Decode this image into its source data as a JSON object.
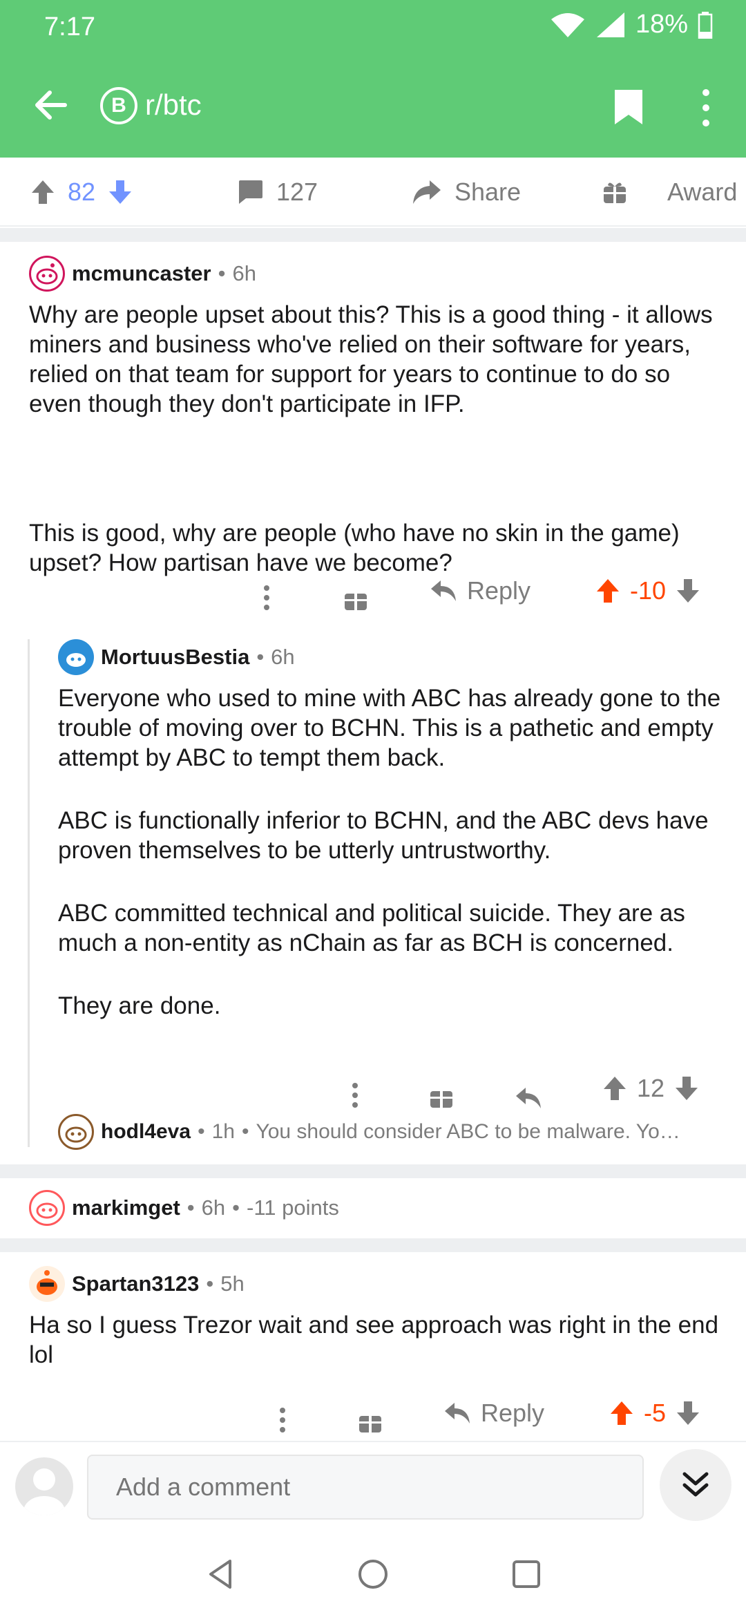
{
  "status": {
    "time": "7:17",
    "battery": "18%"
  },
  "appbar": {
    "subreddit": "r/btc",
    "sub_icon_letter": "B"
  },
  "post_actions": {
    "score": "82",
    "comments": "127",
    "share": "Share",
    "award": "Award"
  },
  "comments": [
    {
      "user": "mcmuncaster",
      "age": "6h",
      "body": [
        "Why are people upset about this? This is a good thing - it allows miners and business who've relied on their software for years, relied on that team for support for years to continue to do so even though they don't participate in IFP.",
        "",
        "This is good, why are people (who have no skin in the game) upset? How partisan have we become?"
      ],
      "reply": "Reply",
      "score": "-10"
    },
    {
      "user": "MortuusBestia",
      "age": "6h",
      "body": [
        "Everyone who used to mine with ABC has already gone to the trouble of moving over to BCHN. This is a pathetic and empty attempt by ABC to tempt them back.",
        "ABC is functionally inferior to BCHN, and the ABC devs have proven themselves to be utterly untrustworthy.",
        "ABC committed technical and political suicide. They are as much a non-entity as nChain as far as BCH is concerned.",
        "They are done."
      ],
      "score": "12"
    },
    {
      "user": "hodl4eva",
      "age": "1h",
      "preview": "You should consider ABC to be malware.  Yo…"
    },
    {
      "user": "markimget",
      "age": "6h",
      "points": "-11 points"
    },
    {
      "user": "Spartan3123",
      "age": "5h",
      "body": [
        "Ha so I guess Trezor wait and see approach was right in the end lol"
      ],
      "reply": "Reply",
      "score": "-5"
    }
  ],
  "composer": {
    "placeholder": "Add a comment"
  },
  "colors": {
    "appbar": "#5fcb76",
    "upvoted": "#ff4500",
    "accent_blue": "#7193ff"
  }
}
